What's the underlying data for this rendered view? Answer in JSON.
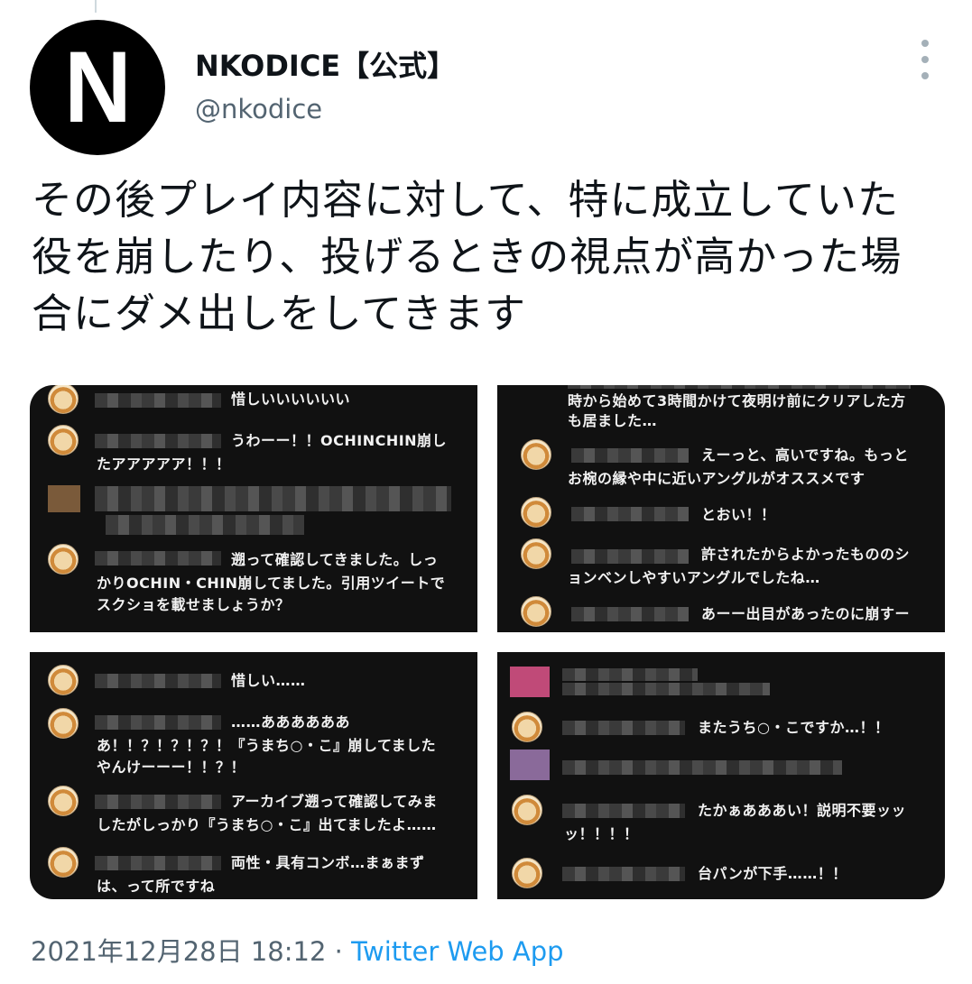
{
  "tweet": {
    "display_name": "NKODICE【公式】",
    "handle": "@nkodice",
    "avatar_letter": "N",
    "text": "その後プレイ内容に対して、特に成立していた役を崩したり、投げるときの視点が高かった場合にダメ出しをしてきます",
    "timestamp": "2021年12月28日 18:12",
    "separator": "·",
    "source": "Twitter Web App"
  },
  "images": {
    "p1": [
      "惜しいいいいいい",
      "うわーー！！OCHINCHIN崩し",
      "たアアアアア！！！",
      "遡って確認してきました。しっ",
      "かりOCHIN・CHIN崩してました。引用ツイートで",
      "スクショを載せましょうか？"
    ],
    "p2": [
      "時から始めて3時間かけて夜明け前にクリアした方",
      "も居ました…",
      "えーっと、高いですね。もっと",
      "お椀の縁や中に近いアングルがオススメです",
      "とおい！！",
      "許されたからよかったもののシ",
      "ョンベンしやすいアングルでしたね…",
      "あーー出目があったのに崩すー"
    ],
    "p3": [
      "惜しい……",
      "……ああああああ",
      "あ！！？！？！？！『うまち○・こ』崩してました",
      "やんけーーー！！？！",
      "アーカイブ遡って確認してみま",
      "したがしっかり『うまち○・こ』出てましたよ……",
      "両性・具有コンボ…まぁまず",
      "は、って所ですね"
    ],
    "p4": [
      "またうち○・こですか…！！",
      "たかぁあああい！説明不要ッッ",
      "ッ！！！！",
      "台パンが下手……！！"
    ]
  },
  "colors": {
    "link": "#1d9bf0",
    "secondary": "#536471",
    "panel_bg": "#111111"
  }
}
